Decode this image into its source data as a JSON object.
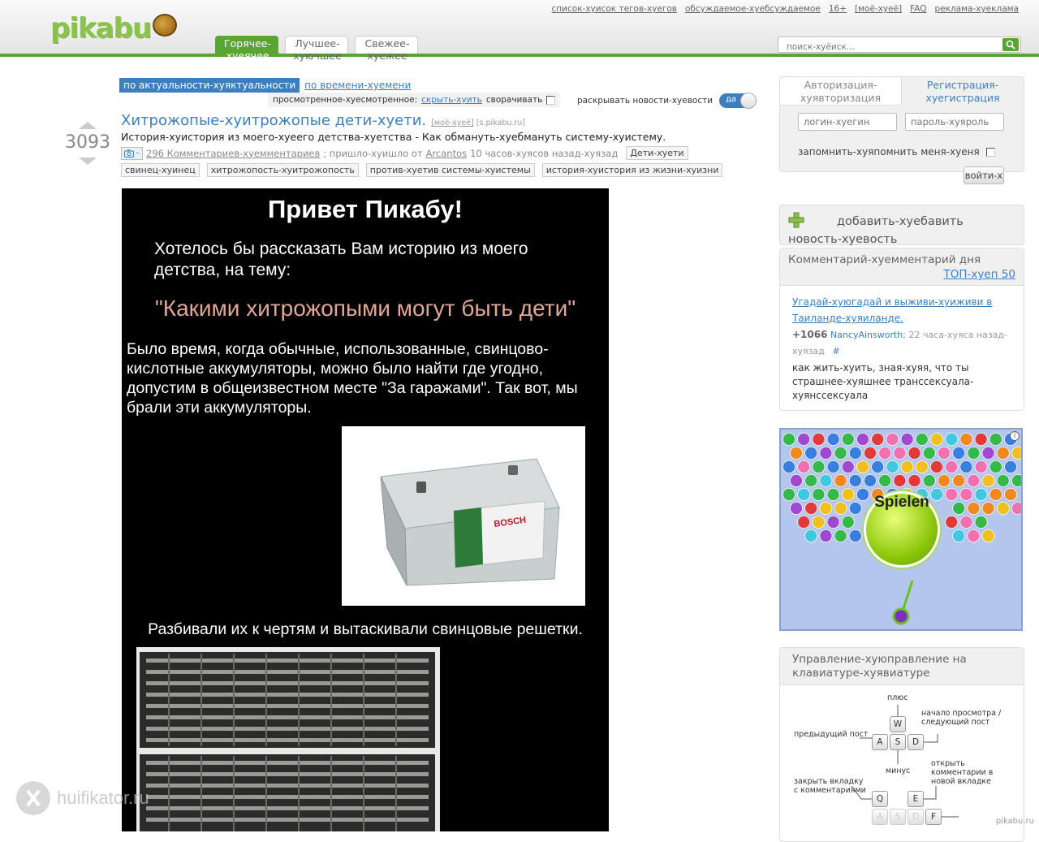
{
  "header": {
    "logo_text": "pikabu",
    "links": [
      "список-хуисок тегов-хуегов",
      "обсуждаемое-хуебсуждаемое",
      "16+",
      "[моё-хуеё]",
      "FAQ",
      "реклама-хуеклама"
    ],
    "tabs": [
      "Горячее-хуеячее",
      "Лучшее-хуючшее",
      "Свежее-хуежее"
    ],
    "search_placeholder": "поиск-хуёиск..."
  },
  "sort": {
    "active": "по актуальности-хуяктуальности",
    "other": "по времени-хуемени"
  },
  "view_options": {
    "viewed_label": "просмотренное-хуесмотренное:",
    "hide_link": "скрыть-хуить",
    "collapse_label": "сворачивать",
    "expand_label": "раскрывать новости-хуевости",
    "toggle_label": "да"
  },
  "post": {
    "rating": "3093",
    "title": "Хитрожопые-хуитрожопые дети-хуети.",
    "mine_link": "[моё-хуеё]",
    "source": "[s.pikabu.ru]",
    "description": "История-хуистория из моего-хуеего детства-хуетства - Как обмануть-хуебмануть систему-хуистему.",
    "camera_label": "–",
    "comments_link": "296 Комментариев-хуемментариев",
    "posted_prefix": "; пришло-хуишло от",
    "author": "Arcantos",
    "time": "10 часов-хуясов назад-хуязад",
    "tag_inline": "Дети-хуети",
    "tags": [
      "свинец-хуинец",
      "хитрожопость-хуитрожопость",
      "против-хуетив системы-хуистемы",
      "история-хуистория из жизни-хуизни"
    ]
  },
  "picture": {
    "title": "Привет Пикабу!",
    "intro": "Хотелось бы рассказать Вам историю из моего детства, на тему:",
    "headline": "\"Какими хитрожопыми могут быть дети\"",
    "paragraph": "Было время, когда обычные, использованные, свинцово-кислотные аккумуляторы, можно было найти где угодно, допустим в общеизвестном месте \"За гаражами\". Так вот, мы брали эти аккумуляторы.",
    "battery_brand": "BOSCH",
    "caption2": "Разбивали их к чертям и вытаскивали свинцовые решетки."
  },
  "login": {
    "tab_login": "Авторизация-хуявторизация",
    "tab_register": "Регистрация-хуегистрация",
    "login_placeholder": "логин-хуегин",
    "password_placeholder": "пароль-хуяроль",
    "remember": "запомнить-хуяпомнить меня-хуеня",
    "submit": "войти-х"
  },
  "add_news": {
    "label": "добавить-хуебавить новость-хуевость"
  },
  "comment_of_day": {
    "title": "Комментарий-хуемментарий дня",
    "top_link": "ТОП-хуеп 50",
    "post_link": "Угадай-хуюгадай и выживи-хуиживи в Таиланде-хуяиланде.",
    "score": "+1066",
    "user": "NancyAinsworth",
    "time": "; 22 часа-хуяса назад-хуязад",
    "hash": "#",
    "text": "как жить-хуить, зная-хуяя, что ты страшнее-хуяшнее транссексуала-хуянссексуала"
  },
  "ad": {
    "play_label": "Spielen",
    "info": "i"
  },
  "keys_box": {
    "title": "Управление-хуюправление на клавиатуре-хуявиатуре",
    "labels": {
      "plus": "плюс",
      "next": "начало просмотра / следующий пост",
      "prev": "предыдущий пост",
      "minus": "минус",
      "open_comments": "открыть комментарии в новой вкладке",
      "close_tab": "закрыть вкладку с комментариями"
    },
    "keys": [
      "W",
      "A",
      "S",
      "D",
      "Q",
      "E",
      "A",
      "S",
      "D",
      "F"
    ]
  },
  "watermark": "huifikator.ru",
  "credit": "pikabu.ru",
  "colors": {
    "accent_green": "#5aa532",
    "link_blue": "#3b7fc1"
  }
}
